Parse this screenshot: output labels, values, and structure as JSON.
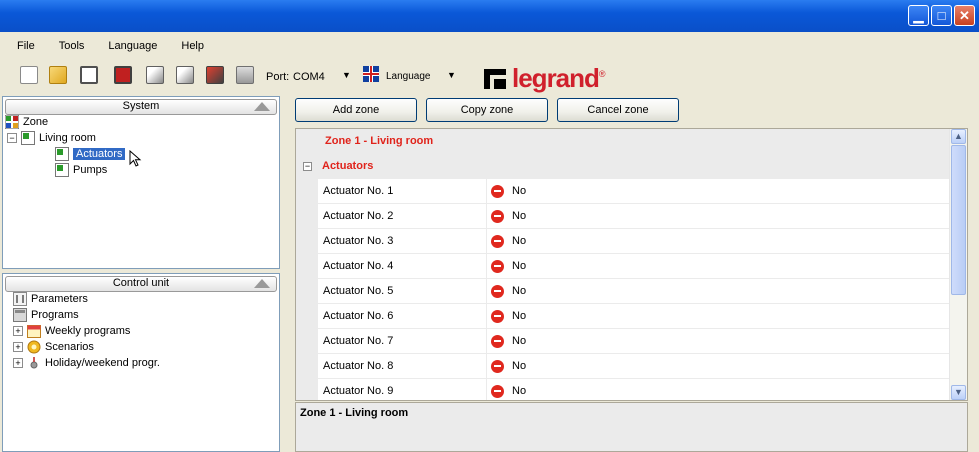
{
  "window": {
    "minimize_icon": "minimize-icon",
    "maximize_icon": "maximize-icon",
    "close_icon": "close-icon"
  },
  "menu": {
    "items": [
      "File",
      "Tools",
      "Language",
      "Help"
    ]
  },
  "toolbar": {
    "icons": [
      "new-icon",
      "open-icon",
      "save-icon",
      "delete-icon",
      "action-icon",
      "action-icon",
      "send-icon",
      "report-icon"
    ],
    "port_label": "Port:",
    "port_value": "COM4",
    "language_label": "Language"
  },
  "brand": {
    "logo_text": "legrand",
    "registered": "®",
    "color": "#d0202c"
  },
  "system_panel": {
    "title": "System",
    "tree": {
      "zone": "Zone",
      "living_room": "Living room",
      "actuators": "Actuators",
      "pumps": "Pumps"
    }
  },
  "control_panel": {
    "title": "Control unit",
    "tree": {
      "parameters": "Parameters",
      "programs": "Programs",
      "weekly": "Weekly programs",
      "scenarios": "Scenarios",
      "holiday": "Holiday/weekend progr."
    }
  },
  "buttons": {
    "add_zone": "Add zone",
    "copy_zone": "Copy zone",
    "cancel_zone": "Cancel zone"
  },
  "grid": {
    "zone_title": "Zone 1 - Living room",
    "group_label": "Actuators",
    "group_expander": "−",
    "rows": [
      {
        "name": "Actuator No. 1",
        "value": "No"
      },
      {
        "name": "Actuator No. 2",
        "value": "No"
      },
      {
        "name": "Actuator No. 3",
        "value": "No"
      },
      {
        "name": "Actuator No. 4",
        "value": "No"
      },
      {
        "name": "Actuator No. 5",
        "value": "No"
      },
      {
        "name": "Actuator No. 6",
        "value": "No"
      },
      {
        "name": "Actuator No. 7",
        "value": "No"
      },
      {
        "name": "Actuator No. 8",
        "value": "No"
      },
      {
        "name": "Actuator No. 9",
        "value": "No"
      }
    ]
  },
  "status": {
    "title": "Zone 1 - Living room"
  },
  "colors": {
    "title_bar": "#0a58d8",
    "selection": "#316ac5",
    "accent_red": "#e0231b"
  }
}
